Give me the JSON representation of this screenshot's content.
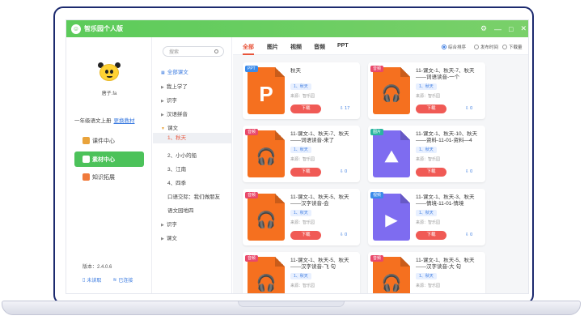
{
  "app": {
    "title": "智乐园个人版",
    "controls": [
      "⚙",
      "—",
      "□",
      "✕"
    ]
  },
  "user": {
    "name": "唐子.fa",
    "textbook": "一年级语文上册",
    "switch_label": "更换教材"
  },
  "nav": [
    {
      "label": "课件中心",
      "active": false,
      "color": "#e9a33b"
    },
    {
      "label": "素材中心",
      "active": true,
      "color": "#ffffff"
    },
    {
      "label": "知识拓展",
      "active": false,
      "color": "#f07a3b"
    }
  ],
  "footer": {
    "version": "版本：2.4.0.6",
    "left": "未读取",
    "right": "已连接"
  },
  "tree": {
    "search_placeholder": "搜索",
    "items": [
      {
        "label": "全部课文",
        "arrow": "▦",
        "level": 0
      },
      {
        "label": "我上学了",
        "arrow": "▶",
        "level": 0
      },
      {
        "label": "识字",
        "arrow": "▶",
        "level": 0
      },
      {
        "label": "汉语拼音",
        "arrow": "▶",
        "level": 0
      },
      {
        "label": "课文",
        "arrow": "▼",
        "level": 0
      },
      {
        "label": "1、秋天",
        "arrow": "",
        "level": 1
      },
      {
        "label": "2、小小的船",
        "arrow": "",
        "level": 1
      },
      {
        "label": "3、江南",
        "arrow": "",
        "level": 1
      },
      {
        "label": "4、四季",
        "arrow": "",
        "level": 1
      },
      {
        "label": "口语交际：我们做朋友",
        "arrow": "",
        "level": 1
      },
      {
        "label": "语文园地四",
        "arrow": "",
        "level": 1
      },
      {
        "label": "识字",
        "arrow": "▶",
        "level": 0
      },
      {
        "label": "课文",
        "arrow": "▶",
        "level": 0
      }
    ]
  },
  "filters": {
    "tabs": [
      "全部",
      "图片",
      "视频",
      "音频",
      "PPT"
    ],
    "sort": [
      "综合排序",
      "发布时间",
      "下载量"
    ]
  },
  "cards": [
    {
      "tag": "PPT",
      "tag_color": "blue",
      "kind": "orange",
      "glyph": "P",
      "title": "秋天",
      "chip": "1、秋天",
      "source": "来源：智乐园",
      "button": "下载",
      "count": "17"
    },
    {
      "tag": "音频",
      "tag_color": "red",
      "kind": "orange",
      "glyph": "🎧",
      "title": "11-课文-1、秋天-7、秋天——词语读音-一个",
      "chip": "1、秋天",
      "source": "来源：智乐园",
      "button": "下载",
      "count": "0"
    },
    {
      "tag": "音频",
      "tag_color": "red",
      "kind": "orange",
      "glyph": "🎧",
      "title": "11-课文-1、秋天-7、秋天——词语读音-来了",
      "chip": "1、秋天",
      "source": "来源：智乐园",
      "button": "下载",
      "count": "0"
    },
    {
      "tag": "图片",
      "tag_color": "teal",
      "kind": "purple",
      "glyph": "⛰",
      "title": "11-课文-1、秋天-10、秋天——资料-11-01-资料—4",
      "chip": "1、秋天",
      "source": "来源：智乐园",
      "button": "下载",
      "count": "0"
    },
    {
      "tag": "音频",
      "tag_color": "red",
      "kind": "orange",
      "glyph": "🎧",
      "title": "11-课文-1、秋天-5、秋天——汉字读音-会",
      "chip": "1、秋天",
      "source": "来源：智乐园",
      "button": "下载",
      "count": "0"
    },
    {
      "tag": "视频",
      "tag_color": "blue",
      "kind": "purple",
      "glyph": "▶",
      "title": "11-课文-1、秋天-3、秋天——情境-11-01-情境",
      "chip": "1、秋天",
      "source": "来源：智乐园",
      "button": "下载",
      "count": "0"
    },
    {
      "tag": "音频",
      "tag_color": "red",
      "kind": "orange",
      "glyph": "🎧",
      "title": "11-课文-1、秋天-5、秋天——汉字读音-飞 句",
      "chip": "1、秋天",
      "source": "来源：智乐园",
      "button": "下载",
      "count": "0"
    },
    {
      "tag": "音频",
      "tag_color": "red",
      "kind": "orange",
      "glyph": "🎧",
      "title": "11-课文-1、秋天-5、秋天——汉字读音-大 句",
      "chip": "1、秋天",
      "source": "来源：智乐园",
      "button": "下载",
      "count": "0"
    }
  ]
}
